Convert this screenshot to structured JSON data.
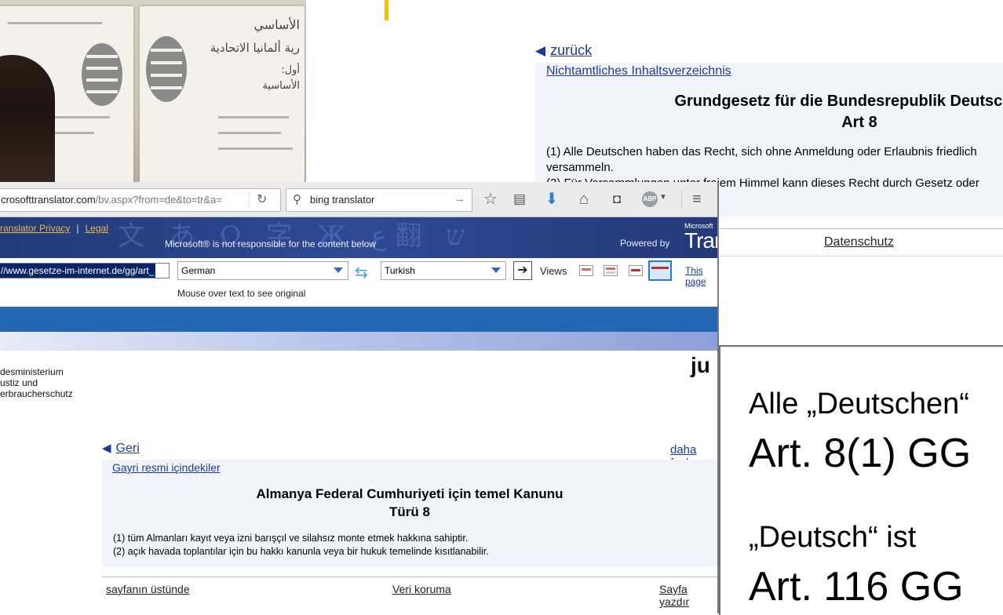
{
  "photo": {
    "arabic_lines": [
      "الأساسي",
      "رية ألمانيا الاتحادية",
      "أول:",
      "الأساسية"
    ]
  },
  "german_page": {
    "back_link": "zurück",
    "toc_link": "Nichtamtliches Inhaltsverzeichnis",
    "title_line1": "Grundgesetz für die Bundesrepublik Deutschland",
    "title_line2": "Art 8",
    "para1_line1": "(1) Alle Deutschen haben das Recht, sich ohne Anmeldung oder Erlaubnis friedlich",
    "para1_line2": "versammeln.",
    "para2": "(2) Für Versammlungen unter freiem Himmel kann dieses Recht durch Gesetz oder",
    "footer_link": "Datenschutz"
  },
  "browser": {
    "url_host": "crosofttranslator.com",
    "url_path": "/bv.aspx?from=de&to=tr&a=",
    "search_placeholder": "bing translator",
    "icons": [
      "star-icon",
      "reading-list-icon",
      "download-icon",
      "home-icon",
      "pocket-icon",
      "adblock-icon",
      "menu-icon"
    ],
    "banner_link1": "ranslator Privacy",
    "banner_sep": "|",
    "banner_link2": "Legal",
    "banner_note": "Microsoft® is not responsible for the content below",
    "powered_by": "Powered by",
    "brand_small": "Microsoft",
    "brand_name": "Translator",
    "source_url": "//www.gesetze-im-internet.de/gg/art_",
    "from_lang": "German",
    "to_lang": "Turkish",
    "views_label": "Views",
    "this_page_link": "This page",
    "mouse_hint": "Mouse over text to see original",
    "colors": {
      "banner": "#2e4a93",
      "strip": "#2566b4",
      "link": "#1a3c96",
      "banner_link": "#f0b540"
    }
  },
  "ministry": {
    "line1": "desministerium",
    "line2": "ustiz und",
    "line3": "erbraucherschutz",
    "logo_partial": "ju"
  },
  "translated_page": {
    "back_link": "Geri",
    "more_link": "daha fazla",
    "toc_link": "Gayri resmi içindekiler",
    "title_line1": "Almanya Federal Cumhuriyeti için temel Kanunu",
    "title_line2": "Türü 8",
    "para1": "(1) tüm Almanları kayıt veya izni barışçıl ve silahsız monte etmek hakkına sahiptir.",
    "para2": "(2) açık havada toplantılar için bu hakkı kanunla veya bir hukuk temelinde kısıtlanabilir.",
    "footer_top": "sayfanın üstünde",
    "footer_privacy": "Veri koruma",
    "footer_print": "Sayfa yazdır"
  },
  "slide": {
    "line1": "Alle „Deutschen“",
    "line2": "Art. 8(1) GG",
    "line3": "„Deutsch“ ist",
    "line4": "Art. 116 GG"
  }
}
